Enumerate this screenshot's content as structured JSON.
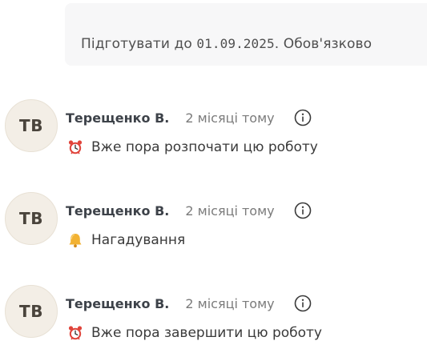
{
  "task_note": {
    "text_prefix": "Підготувати до ",
    "date": "01.09.2025",
    "text_suffix": ". Обов'язково"
  },
  "comments": [
    {
      "avatar_initials": "ТВ",
      "author": "Терещенко В.",
      "time": "2 місяці тому",
      "icon": "alarm-clock-icon",
      "message": "Вже пора розпочати цю роботу"
    },
    {
      "avatar_initials": "ТВ",
      "author": "Терещенко В.",
      "time": "2 місяці тому",
      "icon": "bell-icon",
      "message": "Нагадування"
    },
    {
      "avatar_initials": "ТВ",
      "author": "Терещенко В.",
      "time": "2 місяці тому",
      "icon": "alarm-clock-icon",
      "message": "Вже пора завершити цю роботу"
    }
  ],
  "colors": {
    "note_background": "#f7f7f8",
    "avatar_background": "#f3eee6",
    "alarm_red": "#e0443b",
    "bell_yellow": "#f2b233"
  }
}
